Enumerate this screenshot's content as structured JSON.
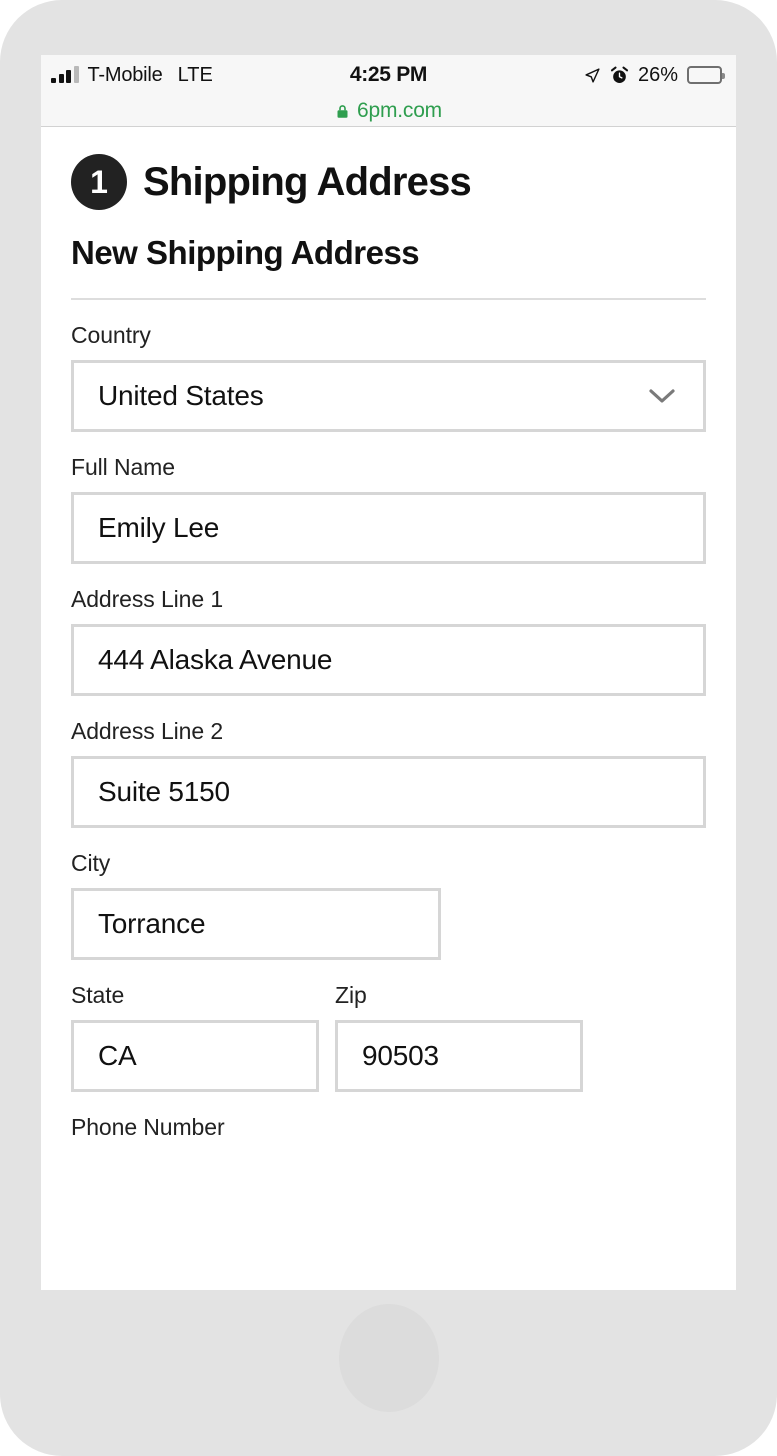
{
  "status_bar": {
    "carrier": "T-Mobile",
    "network": "LTE",
    "time": "4:25 PM",
    "battery_percent": "26%",
    "battery_level": 26,
    "location_icon": "location-arrow-icon",
    "alarm_icon": "alarm-clock-icon",
    "signal_icon": "signal-bars-icon",
    "battery_icon": "battery-icon",
    "battery_color": "#f6c518"
  },
  "browser": {
    "lock_icon": "lock-icon",
    "url": "6pm.com",
    "url_color": "#2f9e4f"
  },
  "checkout": {
    "step_number": "1",
    "step_title": "Shipping Address",
    "subtitle": "New Shipping Address",
    "badge_color": "#222222"
  },
  "form": {
    "country": {
      "label": "Country",
      "value": "United States",
      "chevron_icon": "chevron-down-icon"
    },
    "full_name": {
      "label": "Full Name",
      "value": "Emily Lee"
    },
    "address_line_1": {
      "label": "Address Line 1",
      "value": "444 Alaska Avenue"
    },
    "address_line_2": {
      "label": "Address Line 2",
      "value": "Suite 5150"
    },
    "city": {
      "label": "City",
      "value": "Torrance"
    },
    "state": {
      "label": "State",
      "value": "CA"
    },
    "zip": {
      "label": "Zip",
      "value": "90503"
    },
    "phone": {
      "label": "Phone Number"
    }
  }
}
